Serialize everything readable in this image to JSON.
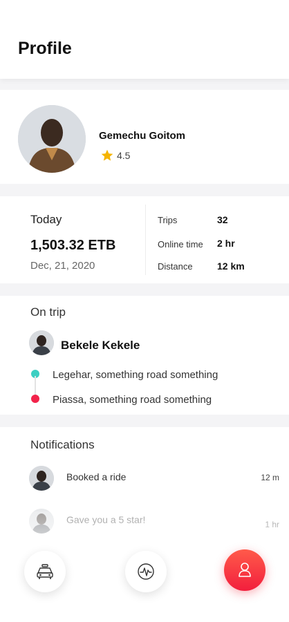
{
  "header": {
    "title": "Profile"
  },
  "profile": {
    "name": "Gemechu Goitom",
    "rating": "4.5"
  },
  "today": {
    "label": "Today",
    "earnings": "1,503.32 ETB",
    "date": "Dec, 21, 2020",
    "stats": [
      {
        "label": "Trips",
        "value": "32"
      },
      {
        "label": "Online time",
        "value": "2 hr"
      },
      {
        "label": "Distance",
        "value": "12 km"
      }
    ]
  },
  "on_trip": {
    "title": "On trip",
    "rider": "Bekele Kekele",
    "pickup": "Legehar, something road something",
    "dropoff": "Piassa, something road something"
  },
  "notifications": {
    "title": "Notifications",
    "items": [
      {
        "text": "Booked a ride",
        "time": "12 m"
      },
      {
        "text": "Gave you a 5 star!",
        "time": "1 hr"
      }
    ]
  },
  "colors": {
    "pickup": "#3ccfc2",
    "dropoff": "#f2234a",
    "star": "#f5b400",
    "accent": "#f2283c"
  },
  "nav": {
    "items": [
      "taxi-icon",
      "activity-icon",
      "profile-icon"
    ],
    "active": "profile-icon"
  }
}
